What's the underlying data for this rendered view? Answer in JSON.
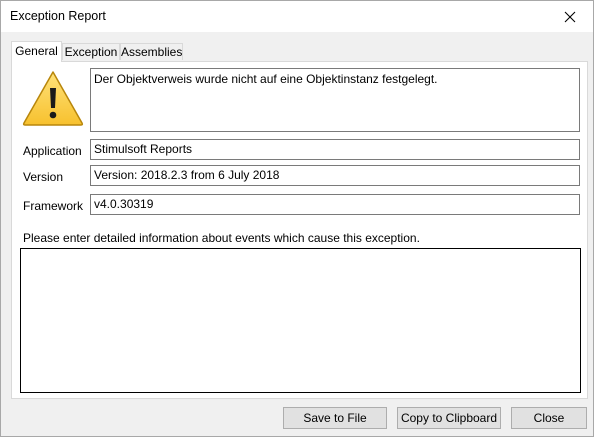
{
  "window": {
    "title": "Exception Report"
  },
  "tabs": [
    {
      "label": "General",
      "active": true
    },
    {
      "label": "Exception",
      "active": false
    },
    {
      "label": "Assemblies",
      "active": false
    }
  ],
  "general": {
    "message": "Der Objektverweis wurde nicht auf eine Objektinstanz festgelegt.",
    "fields": {
      "application": {
        "label": "Application",
        "value": "Stimulsoft Reports"
      },
      "version": {
        "label": "Version",
        "value": "Version: 2018.2.3 from 6 July 2018"
      },
      "framework": {
        "label": "Framework",
        "value": "v4.0.30319"
      }
    },
    "details_prompt": "Please enter detailed information about events which cause this exception.",
    "details_value": ""
  },
  "buttons": {
    "save": "Save to File",
    "copy": "Copy to Clipboard",
    "close": "Close"
  },
  "icons": {
    "close": "close-icon",
    "warning": "warning-icon"
  },
  "colors": {
    "warning_yellow": "#ffd24d",
    "warning_outline": "#b8860b"
  }
}
